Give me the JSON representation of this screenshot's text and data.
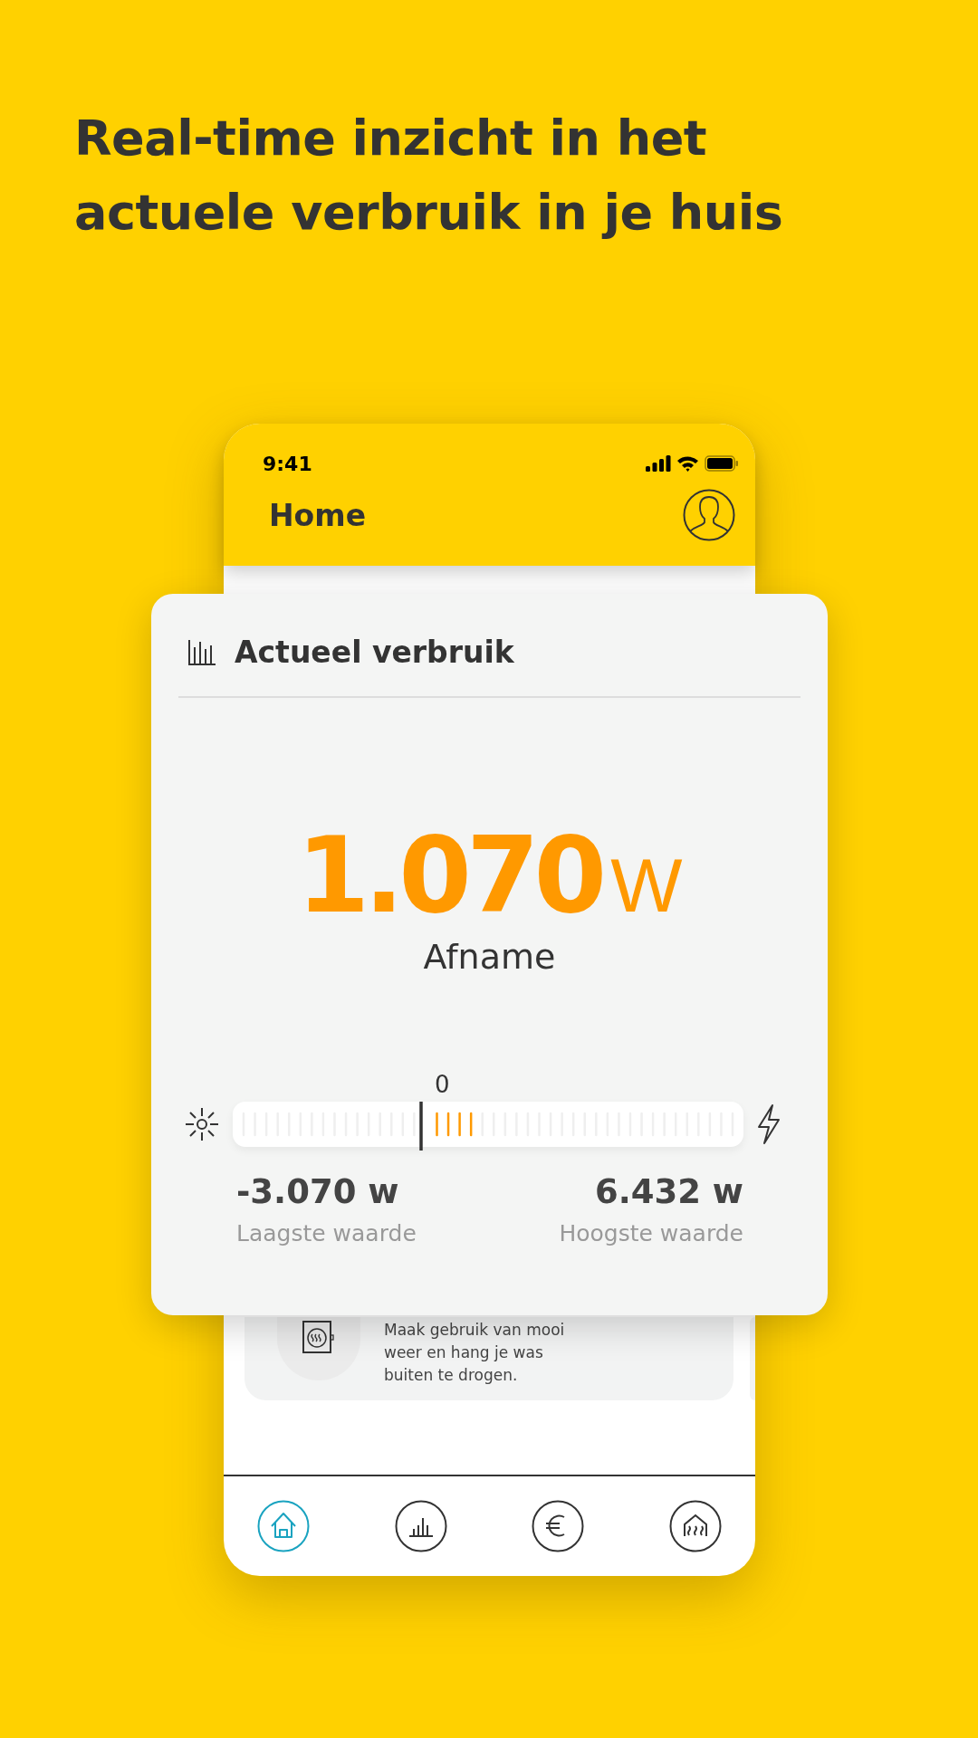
{
  "headline": "Real-time inzicht in het actuele verbruik in je huis",
  "status_bar": {
    "time": "9:41"
  },
  "header": {
    "title": "Home"
  },
  "tip": {
    "text": "Maak gebruik van mooi weer en hang je was buiten te drogen."
  },
  "card": {
    "title": "Actueel verbruik",
    "value": "1.070",
    "unit": "W",
    "direction": "Afname",
    "gauge": {
      "zero_label": "0",
      "level": 0.48
    },
    "low": {
      "value": "-3.070 w",
      "label": "Laagste waarde"
    },
    "high": {
      "value": "6.432 w",
      "label": "Hoogste waarde"
    }
  },
  "tabs": [
    {
      "selected": true
    },
    {
      "selected": false
    },
    {
      "selected": false
    },
    {
      "selected": false
    }
  ]
}
